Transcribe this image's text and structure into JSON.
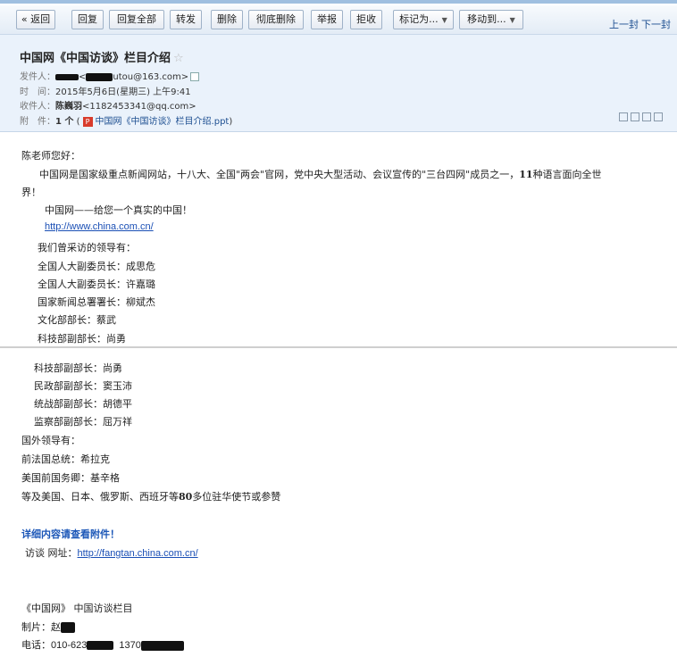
{
  "toolbar": {
    "back": "« 返回",
    "reply": "回复",
    "reply_all": "回复全部",
    "forward": "转发",
    "delete": "删除",
    "delete_forever": "彻底删除",
    "report": "举报",
    "reject": "拒收",
    "mark_as": "标记为...",
    "move_to": "移动到...",
    "prev": "上一封",
    "next": "下一封"
  },
  "header": {
    "subject": "中国网《中国访谈》栏目介绍",
    "star": "☆",
    "from_label": "发件人：",
    "from_value": "<",
    "from_email": "utou@163.com>",
    "time_label": "时　间：",
    "time_value": "2015年5月6日(星期三) 上午9:41",
    "to_label": "收件人：",
    "to_name": "陈巍羽",
    "to_email": "<1182453341@qq.com>",
    "attach_label": "附　件：",
    "attach_count": "1 个",
    "attach_open": "(",
    "attach_name": "中国网《中国访谈》栏目介绍.ppt",
    "attach_close": ")"
  },
  "body": {
    "greeting": "陈老师您好：",
    "p1": "中国网是国家级重点新闻网站，十八大、全国\"两会\"官网，党中央大型活动、会议宣传的\"三台四网\"成员之一，",
    "p1_bold": "11",
    "p1_end": "种语言面向全世",
    "p1_cont": "界！",
    "slogan": "中国网——给您一个真实的中国！",
    "url1": "http://www.china.com.cn/",
    "leaders_title": "我们曾采访的领导有：",
    "leaders_top": [
      "全国人大副委员长：成思危",
      "全国人大副委员长：许嘉璐",
      "国家新闻总署署长：柳斌杰",
      "文化部部长：蔡武",
      "科技部副部长：尚勇"
    ],
    "leaders_bottom": [
      "科技部副部长：尚勇",
      "民政部副部长：窦玉沛",
      "统战部副部长：胡德平",
      "监察部副部长：屈万祥"
    ],
    "foreign_title": "国外领导有：",
    "foreign": [
      "前法国总统：希拉克",
      "美国前国务卿：基辛格"
    ],
    "ambassadors_pre": "等及美国、日本、俄罗斯、西班牙等",
    "ambassadors_num": "80",
    "ambassadors_post": "多位驻华使节或参赞",
    "detail": "详细内容请查看附件！",
    "visit_label": "访谈 网址：",
    "url2": "http://fangtan.china.com.cn/",
    "sig_title": "《中国网》 中国访谈栏目",
    "producer_label": "制片：赵",
    "phone_label": "电话：",
    "phone1": "010-623",
    "phone2": "1370"
  }
}
